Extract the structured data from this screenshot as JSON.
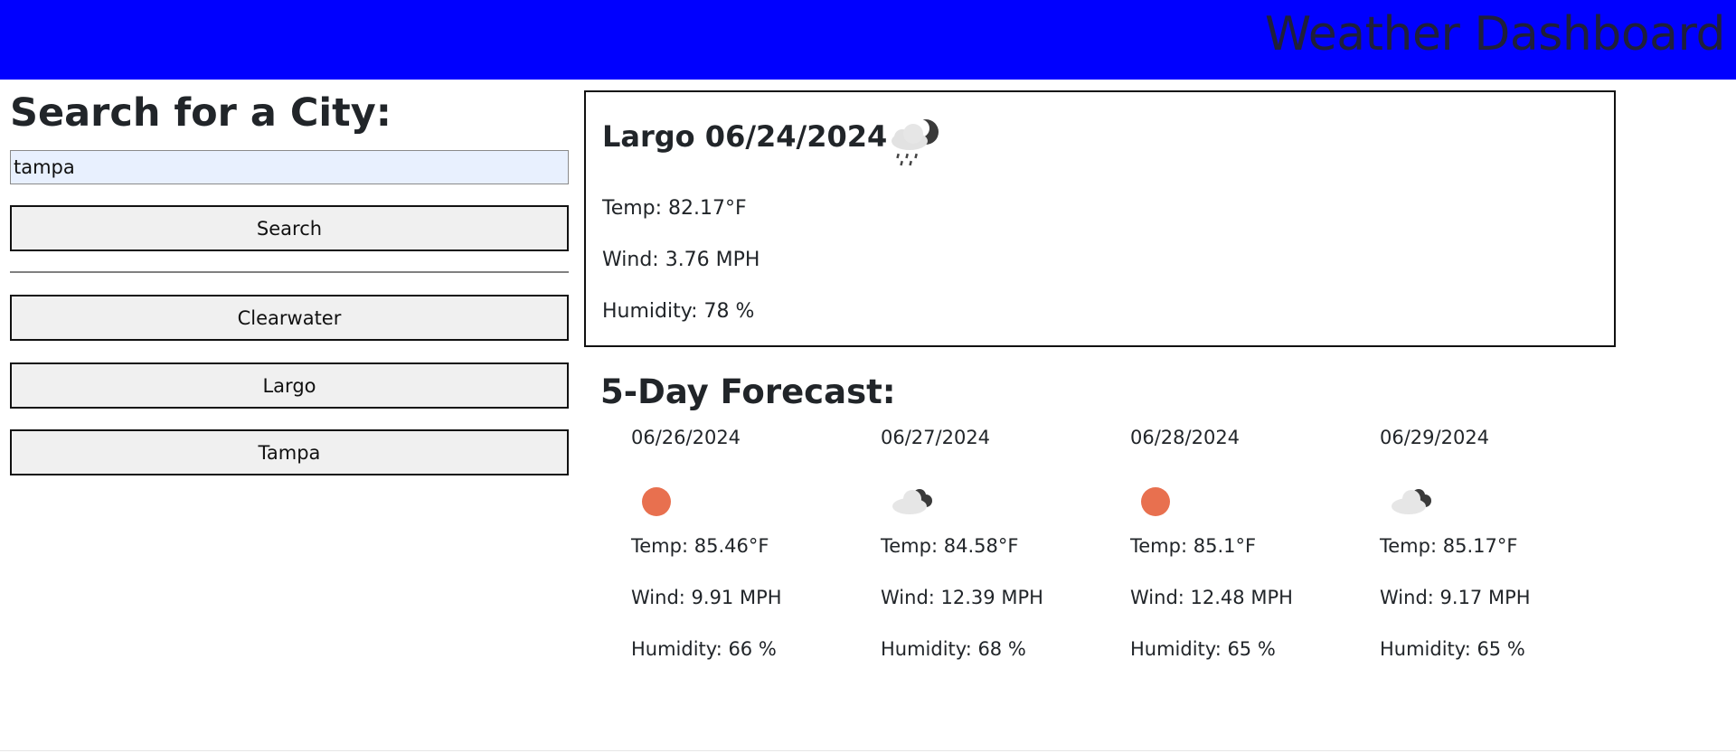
{
  "header": {
    "title": "Weather Dashboard"
  },
  "search": {
    "title": "Search for a City:",
    "input_value": "tampa",
    "button_label": "Search"
  },
  "history": [
    "Clearwater",
    "Largo",
    "Tampa"
  ],
  "current": {
    "title": "Largo 06/24/2024",
    "icon": "rain-night-icon",
    "temp": "Temp: 82.17°F",
    "wind": "Wind: 3.76 MPH",
    "humidity": "Humidity: 78 %"
  },
  "forecast": {
    "title": "5-Day Forecast:",
    "days": [
      {
        "date": "06/26/2024",
        "icon": "sun-icon",
        "temp": "Temp: 85.46°F",
        "wind": "Wind: 9.91 MPH",
        "humidity": "Humidity: 66 %"
      },
      {
        "date": "06/27/2024",
        "icon": "cloud-icon",
        "temp": "Temp: 84.58°F",
        "wind": "Wind: 12.39 MPH",
        "humidity": "Humidity: 68 %"
      },
      {
        "date": "06/28/2024",
        "icon": "sun-icon",
        "temp": "Temp: 85.1°F",
        "wind": "Wind: 12.48 MPH",
        "humidity": "Humidity: 65 %"
      },
      {
        "date": "06/29/2024",
        "icon": "cloud-icon",
        "temp": "Temp: 85.17°F",
        "wind": "Wind: 9.17 MPH",
        "humidity": "Humidity: 65 %"
      }
    ]
  },
  "colors": {
    "header_bg": "#0000ff",
    "sun": "#e8704f",
    "input_bg": "#e8f0fe"
  }
}
